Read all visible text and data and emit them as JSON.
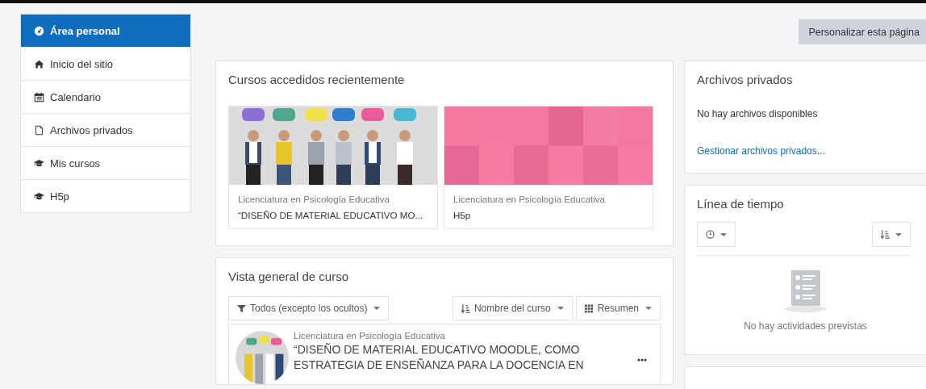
{
  "sidebar": {
    "items": [
      {
        "label": "Área personal",
        "kind": "dashboard",
        "selected": true
      },
      {
        "label": "Inicio del sitio",
        "kind": "home",
        "selected": false
      },
      {
        "label": "Calendario",
        "kind": "calendar",
        "selected": false
      },
      {
        "label": "Archivos privados",
        "kind": "file",
        "selected": false
      },
      {
        "label": "Mis cursos",
        "kind": "cap",
        "selected": false
      },
      {
        "label": "H5p",
        "kind": "cap",
        "selected": false
      }
    ]
  },
  "header": {
    "button": "Personalizar esta página"
  },
  "recent_courses": {
    "title": "Cursos accedidos recientemente",
    "courses": [
      {
        "category": "Licenciatura en Psicología Educativa",
        "name": "“DISEÑO DE MATERIAL EDUCATIVO MO..."
      },
      {
        "category": "Licenciatura en Psicología Educativa",
        "name": "H5p",
        "kind": "pattern"
      }
    ]
  },
  "course_overview": {
    "title": "Vista general de curso",
    "filter": "Todos (excepto los ocultos)",
    "sort": "Nombre del curso",
    "view": "Resumen",
    "courses": [
      {
        "category": "Licenciatura en Psicología Educativa",
        "name": "“DISEÑO DE MATERIAL EDUCATIVO MOODLE, COMO ESTRATEGIA DE ENSEÑANZA PARA LA DOCENCIA EN"
      }
    ]
  },
  "private_files": {
    "title": "Archivos privados",
    "empty": "No hay archivos disponibles",
    "link": "Gestionar archivos privados..."
  },
  "timeline": {
    "title": "Línea de tiempo",
    "empty": "No hay actividades previstas"
  }
}
